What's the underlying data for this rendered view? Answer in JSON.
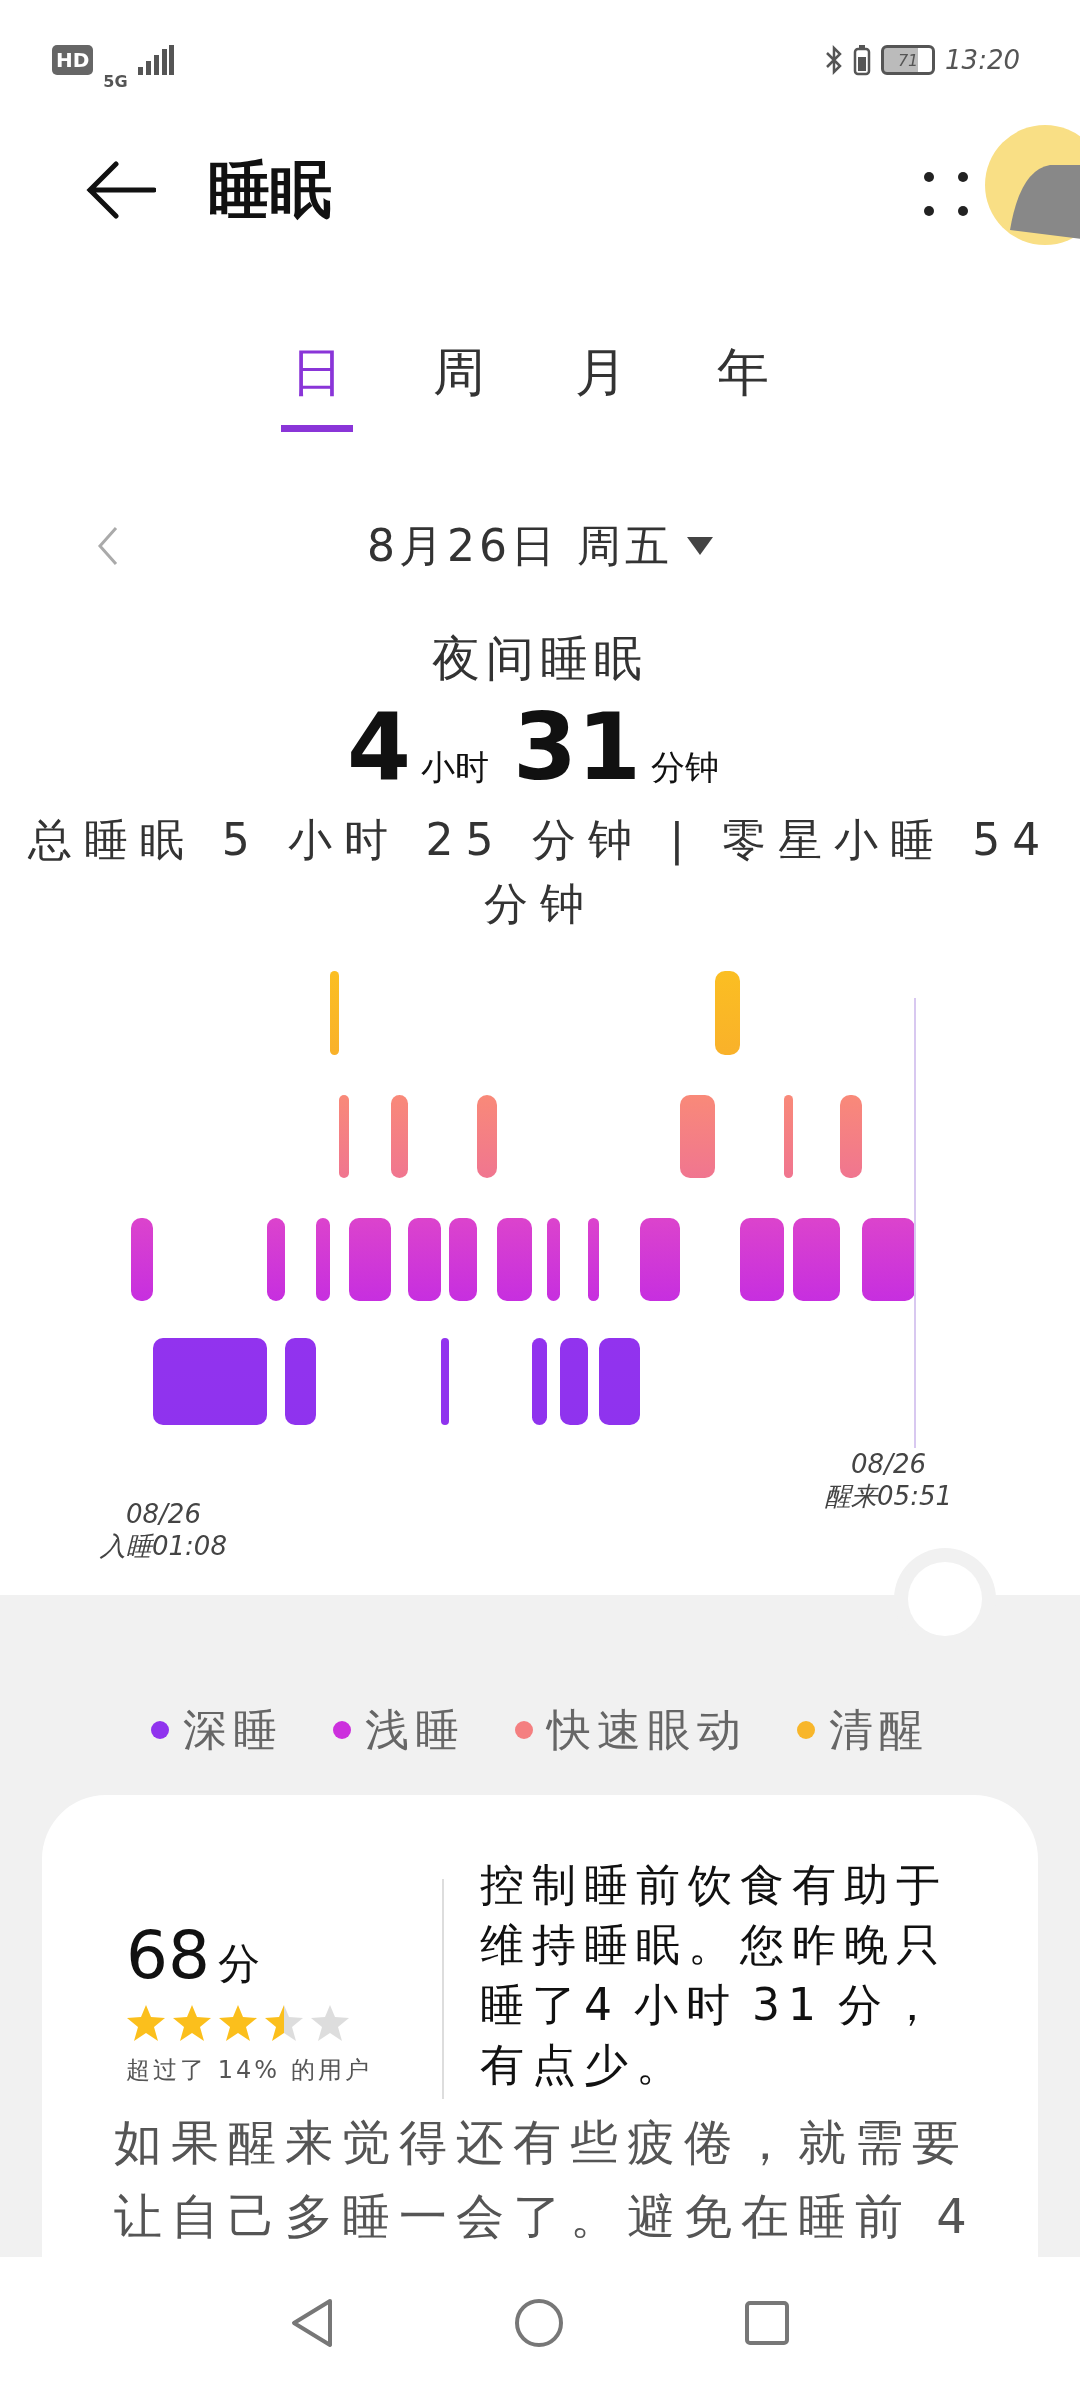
{
  "status_bar": {
    "hd": "HD",
    "network": "5G",
    "battery": "71",
    "time": "13:20"
  },
  "header": {
    "title": "睡眠"
  },
  "tabs": [
    {
      "label": "日",
      "selected": true
    },
    {
      "label": "周",
      "selected": false
    },
    {
      "label": "月",
      "selected": false
    },
    {
      "label": "年",
      "selected": false
    }
  ],
  "date": {
    "label": "8月26日 周五"
  },
  "summary": {
    "title": "夜间睡眠",
    "hours": "4",
    "hours_unit": "小时",
    "minutes": "31",
    "minutes_unit": "分钟",
    "detail": "总睡眠 5 小时 25 分钟 | 零星小睡 54 分钟"
  },
  "chart": {
    "start_date": "08/26",
    "start_label": "入睡01:08",
    "end_date": "08/26",
    "end_label": "醒来05:51"
  },
  "legend": [
    {
      "label": "深睡",
      "color": "#9033ee"
    },
    {
      "label": "浅睡",
      "color": "#cc30dd"
    },
    {
      "label": "快速眼动",
      "color": "#f47f80"
    },
    {
      "label": "清醒",
      "color": "#f8b62a"
    }
  ],
  "score": {
    "value": "68",
    "unit": "分",
    "stars": 3.5,
    "note": "超过了 14% 的用户"
  },
  "advice": "控制睡前饮食有助于维持睡眠。您昨晚只睡了4 小时 31 分，有点少。",
  "tip": "如果醒来觉得还有些疲倦，就需要让自己多睡一会了。避免在睡前 4"
}
